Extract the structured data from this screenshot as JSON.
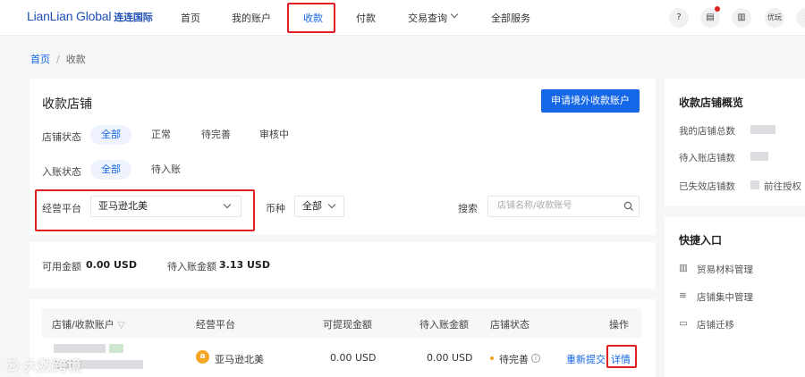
{
  "brand": {
    "logo_text": "LianLian Global",
    "logo_cn": "连连国际"
  },
  "nav": {
    "items": [
      "首页",
      "我的账户",
      "收款",
      "付款",
      "交易查询",
      "全部服务"
    ],
    "active_index": 2
  },
  "header_icons": {
    "user": "优玩"
  },
  "breadcrumb": {
    "home": "首页",
    "sep": "/",
    "current": "收款"
  },
  "stores": {
    "title": "收款店铺",
    "apply_button": "申请境外收款账户",
    "store_status": {
      "label": "店铺状态",
      "options": [
        "全部",
        "正常",
        "待完善",
        "审核中"
      ],
      "selected": 0
    },
    "entry_status": {
      "label": "入账状态",
      "options": [
        "全部",
        "待入账"
      ],
      "selected": 0
    },
    "platform": {
      "label": "经营平台",
      "value": "亚马逊北美"
    },
    "currency": {
      "label": "币种",
      "value": "全部"
    },
    "search": {
      "label": "搜索",
      "placeholder": "店铺名称/收款账号"
    }
  },
  "balance": {
    "available_label": "可用金额",
    "available_value": "0.00 USD",
    "pending_label": "待入账金额",
    "pending_value": "3.13 USD"
  },
  "table": {
    "headers": [
      "店铺/收款账户",
      "经营平台",
      "可提现金额",
      "待入账金额",
      "店铺状态",
      "操作"
    ],
    "rows": [
      {
        "platform": "亚马逊北美",
        "platform_badge": "a",
        "withdrawable": "0.00 USD",
        "pending": "0.00 USD",
        "status": "待完善",
        "action_resubmit": "重新提交",
        "action_detail": "详情"
      }
    ]
  },
  "sidebar": {
    "overview_title": "收款店铺概览",
    "overview_items": [
      "我的店铺总数",
      "待入账店铺数",
      "已失效店铺数"
    ],
    "authorize_link": "前往授权",
    "quick_title": "快捷入口",
    "quick_items": [
      "贸易材料管理",
      "店铺集中管理",
      "店铺迁移"
    ]
  },
  "watermark": "大数跨境",
  "colors": {
    "accent": "#1467e6",
    "highlight": "#e02020",
    "status_dot": "#f0a020",
    "badge": "#f5a623"
  }
}
